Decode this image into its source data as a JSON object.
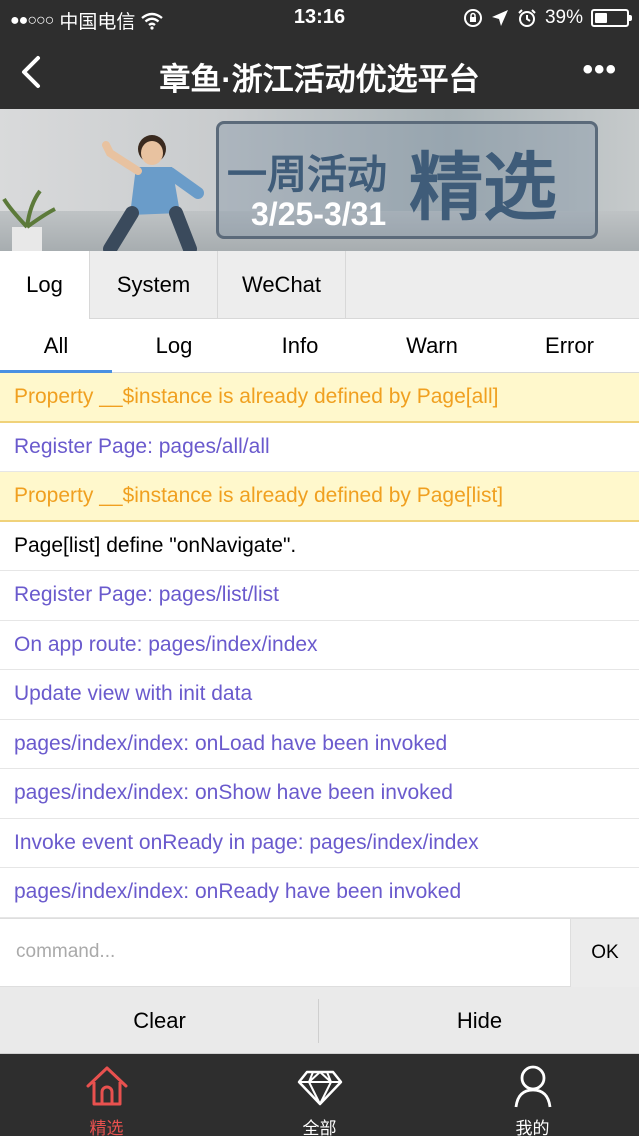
{
  "status_bar": {
    "signal_dots": "●●○○○",
    "carrier": "中国电信",
    "time": "13:16",
    "battery_text": "39%"
  },
  "navbar": {
    "title": "章鱼·浙江活动优选平台",
    "more": "•••"
  },
  "banner": {
    "text_small": "一周活动",
    "text_big": "精选",
    "dates": "3/25-3/31"
  },
  "console": {
    "main_tabs": [
      "Log",
      "System",
      "WeChat"
    ],
    "filter_tabs": [
      "All",
      "Log",
      "Info",
      "Warn",
      "Error"
    ],
    "active_filter": "All",
    "logs": [
      {
        "type": "warn",
        "text": "Property __$instance is already defined by Page[all]"
      },
      {
        "type": "info",
        "text": "Register Page: pages/all/all"
      },
      {
        "type": "warn",
        "text": "Property __$instance is already defined by Page[list]"
      },
      {
        "type": "log",
        "text": "Page[list] define \"onNavigate\"."
      },
      {
        "type": "info",
        "text": "Register Page: pages/list/list"
      },
      {
        "type": "info",
        "text": "On app route: pages/index/index"
      },
      {
        "type": "info",
        "text": "Update view with init data"
      },
      {
        "type": "info",
        "text": "pages/index/index: onLoad have been invoked"
      },
      {
        "type": "info",
        "text": "pages/index/index: onShow have been invoked"
      },
      {
        "type": "info",
        "text": "Invoke event onReady in page: pages/index/index"
      },
      {
        "type": "info",
        "text": "pages/index/index: onReady have been invoked"
      }
    ],
    "command_placeholder": "command...",
    "ok_label": "OK",
    "clear_label": "Clear",
    "hide_label": "Hide"
  },
  "tabbar": {
    "items": [
      {
        "label": "精选",
        "icon": "home-icon",
        "active": true
      },
      {
        "label": "全部",
        "icon": "diamond-icon",
        "active": false
      },
      {
        "label": "我的",
        "icon": "user-icon",
        "active": false
      }
    ]
  },
  "colors": {
    "dark_bar": "#2e2e2e",
    "warn_text": "#f0a020",
    "warn_bg": "#fff8cc",
    "info_text": "#6a5acd",
    "active_tab": "#e8514f",
    "filter_underline": "#4a90e2"
  }
}
